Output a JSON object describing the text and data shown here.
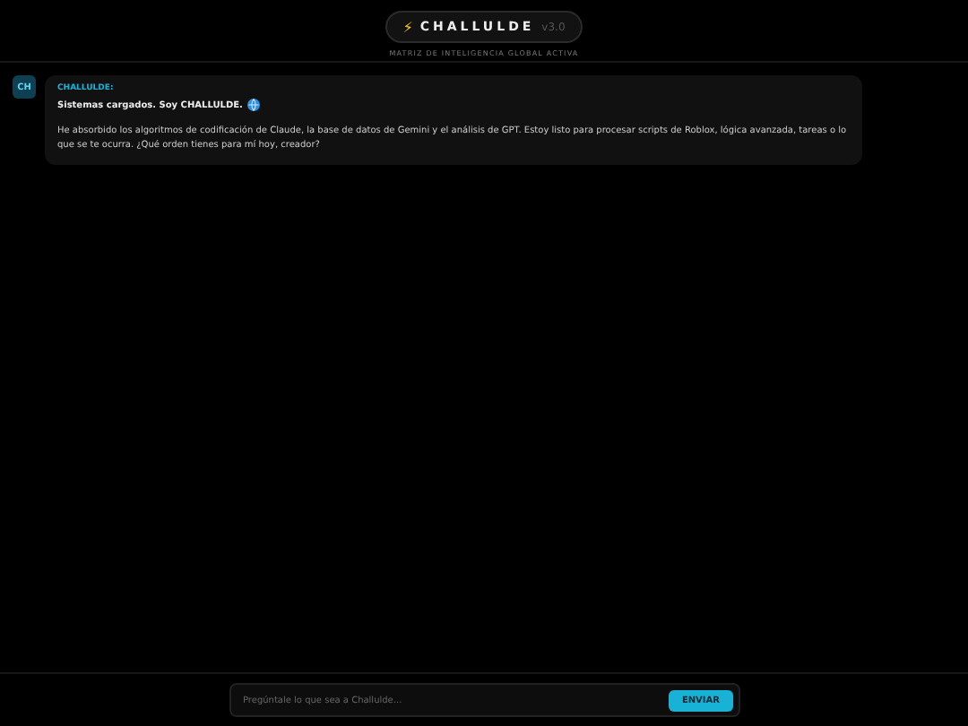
{
  "header": {
    "icon": "⚡",
    "title": "CHALLULDE",
    "version": "v3.0",
    "subtitle": "MATRIZ DE INTELIGENCIA GLOBAL ACTIVA"
  },
  "messages": [
    {
      "avatar": "CH",
      "sender": "CHALLULDE:",
      "headline": "Sistemas cargados. Soy CHALLULDE.",
      "body": "He absorbido los algoritmos de codificación de Claude, la base de datos de Gemini y el análisis de GPT. Estoy listo para procesar scripts de Roblox, lógica avanzada, tareas o lo que se te ocurra. ¿Qué orden tienes para mí hoy, creador?"
    }
  ],
  "composer": {
    "placeholder": "Pregúntale lo que sea a Challulde...",
    "button": "ENVIAR"
  }
}
